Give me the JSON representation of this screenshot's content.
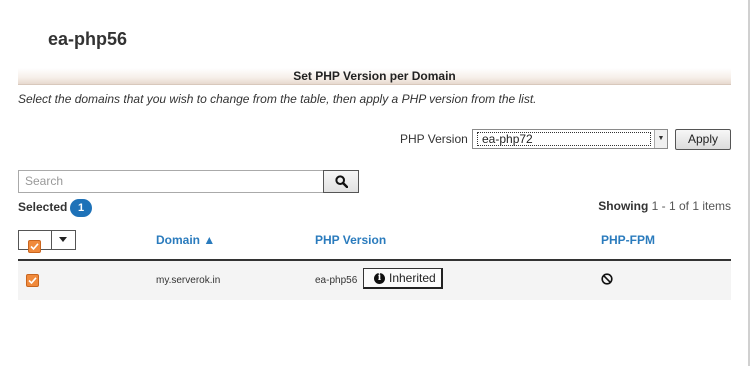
{
  "page": {
    "title": "ea-php56"
  },
  "section": {
    "header": "Set PHP Version per Domain",
    "instructions": "Select the domains that you wish to change from the table, then apply a PHP version from the list."
  },
  "php_version": {
    "label": "PHP Version",
    "selected": "ea-php72",
    "apply_label": "Apply"
  },
  "search": {
    "placeholder": "Search",
    "icon": "search-icon"
  },
  "selection": {
    "label": "Selected",
    "count": "1"
  },
  "pagination": {
    "prefix": "Showing",
    "range": "1 - 1 of 1 items"
  },
  "table": {
    "columns": [
      {
        "label": "Domain ▲"
      },
      {
        "label": "PHP Version"
      },
      {
        "label": "PHP-FPM"
      }
    ],
    "rows": [
      {
        "checked": true,
        "domain": "my.serverok.in",
        "php_version": "ea-php56",
        "inherited_label": "Inherited",
        "php_fpm_icon": "ban-icon"
      }
    ]
  },
  "colors": {
    "accent_link": "#2a7bbd",
    "badge": "#1e72b8",
    "checkbox": "#f08a3c"
  }
}
